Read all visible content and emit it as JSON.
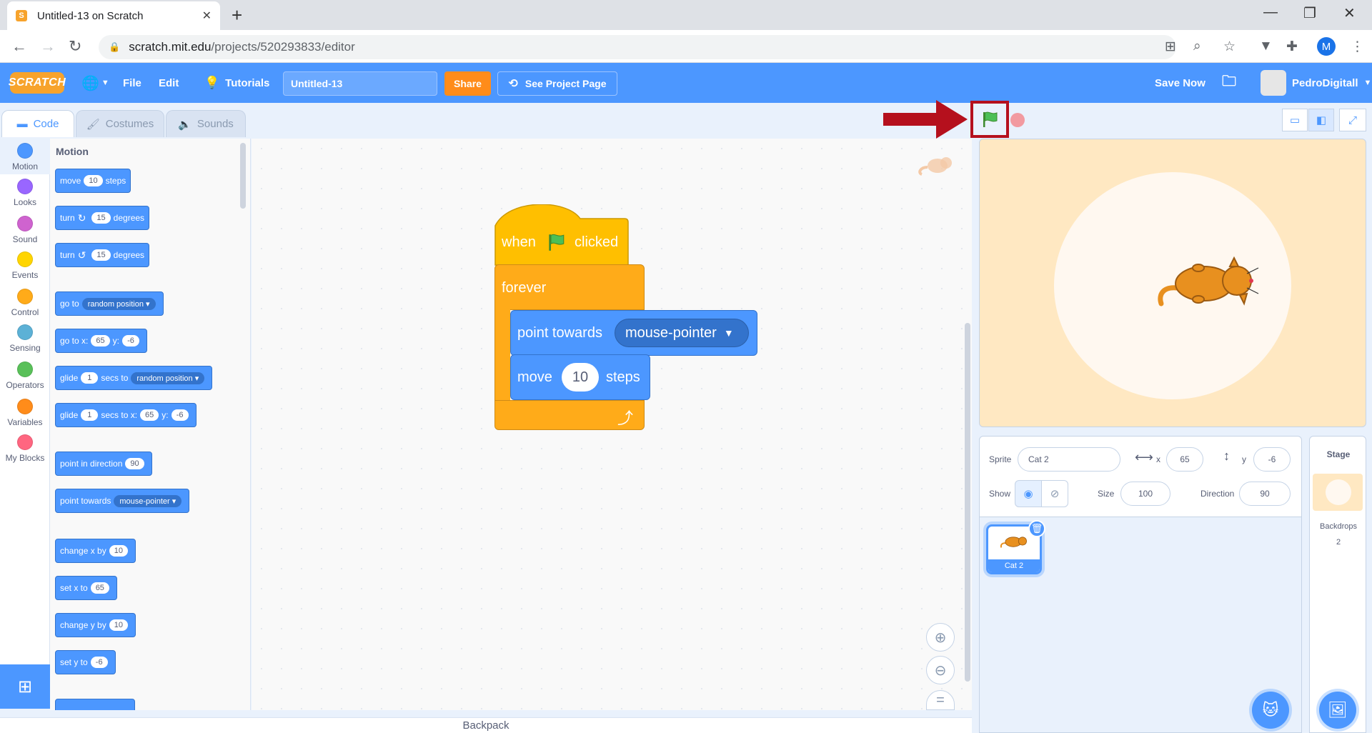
{
  "browser": {
    "tab_title": "Untitled-13 on Scratch",
    "url_host": "scratch.mit.edu",
    "url_path": "/projects/520293833/editor",
    "profile_initial": "M"
  },
  "menu": {
    "logo": "SCRATCH",
    "file": "File",
    "edit": "Edit",
    "tutorials": "Tutorials",
    "project_title": "Untitled-13",
    "share": "Share",
    "see_project_page": "See Project Page",
    "save_now": "Save Now",
    "username": "PedroDigitall"
  },
  "editor_tabs": {
    "code": "Code",
    "costumes": "Costumes",
    "sounds": "Sounds"
  },
  "categories": [
    {
      "label": "Motion",
      "color": "#4c97ff"
    },
    {
      "label": "Looks",
      "color": "#9966ff"
    },
    {
      "label": "Sound",
      "color": "#cf63cf"
    },
    {
      "label": "Events",
      "color": "#ffd500"
    },
    {
      "label": "Control",
      "color": "#ffab19"
    },
    {
      "label": "Sensing",
      "color": "#5cb1d6"
    },
    {
      "label": "Operators",
      "color": "#59c059"
    },
    {
      "label": "Variables",
      "color": "#ff8c1a"
    },
    {
      "label": "My Blocks",
      "color": "#ff6680"
    }
  ],
  "palette": {
    "title": "Motion",
    "move": "move",
    "move_val": "10",
    "steps": "steps",
    "turn": "turn",
    "turn_val": "15",
    "degrees": "degrees",
    "goto": "go to",
    "random_position": "random position",
    "goto_x": "go to x:",
    "x_val": "65",
    "y_label": "y:",
    "y_val": "-6",
    "glide": "glide",
    "glide_val": "1",
    "secs_to": "secs to",
    "secs_to_x": "secs to x:",
    "point_dir": "point in direction",
    "dir_val": "90",
    "point_towards": "point towards",
    "mouse_pointer": "mouse-pointer",
    "change_x": "change x by",
    "change_val": "10",
    "set_x": "set x to",
    "change_y": "change y by",
    "set_y": "set y to"
  },
  "script": {
    "when": "when",
    "clicked": "clicked",
    "forever": "forever",
    "point_towards": "point towards",
    "mouse_pointer": "mouse-pointer",
    "move": "move",
    "move_val": "10",
    "steps": "steps"
  },
  "backpack": "Backpack",
  "sprite_info": {
    "sprite_label": "Sprite",
    "sprite_name": "Cat 2",
    "x_label": "x",
    "x_val": "65",
    "y_label": "y",
    "y_val": "-6",
    "show_label": "Show",
    "size_label": "Size",
    "size_val": "100",
    "direction_label": "Direction",
    "direction_val": "90"
  },
  "sprite_card": {
    "name": "Cat 2"
  },
  "stage_panel": {
    "title": "Stage",
    "backdrops_label": "Backdrops",
    "backdrops_count": "2"
  },
  "colors": {
    "scratch_blue": "#4c97ff",
    "share_orange": "#ff8c1a",
    "control": "#ffab19",
    "events": "#ffbf00",
    "highlight_red": "#b5101d"
  }
}
